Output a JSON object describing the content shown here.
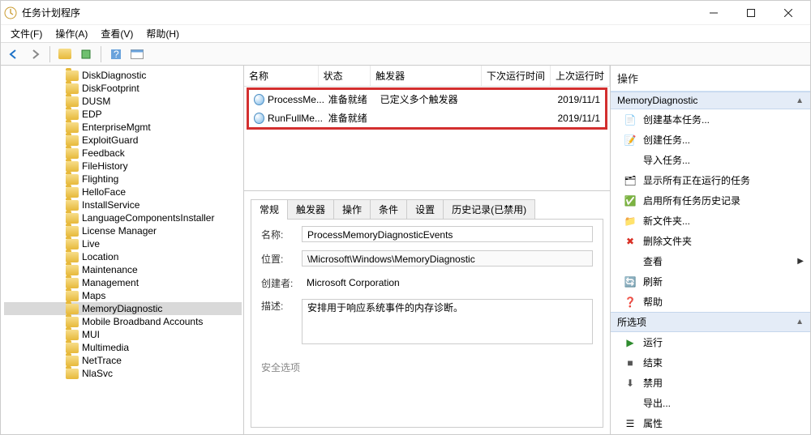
{
  "window": {
    "title": "任务计划程序"
  },
  "menu": {
    "file": "文件(F)",
    "action": "操作(A)",
    "view": "查看(V)",
    "help": "帮助(H)"
  },
  "tree": {
    "items": [
      "DiskDiagnostic",
      "DiskFootprint",
      "DUSM",
      "EDP",
      "EnterpriseMgmt",
      "ExploitGuard",
      "Feedback",
      "FileHistory",
      "Flighting",
      "HelloFace",
      "InstallService",
      "LanguageComponentsInstaller",
      "License Manager",
      "Live",
      "Location",
      "Maintenance",
      "Management",
      "Maps",
      "MemoryDiagnostic",
      "Mobile Broadband Accounts",
      "MUI",
      "Multimedia",
      "NetTrace",
      "NlaSvc"
    ],
    "selected": "MemoryDiagnostic"
  },
  "tasklist": {
    "cols": {
      "name": "名称",
      "state": "状态",
      "trigger": "触发器",
      "next": "下次运行时间",
      "last": "上次运行时"
    },
    "rows": [
      {
        "name": "ProcessMe...",
        "state": "准备就绪",
        "trigger": "已定义多个触发器",
        "next": "",
        "last": "2019/11/1"
      },
      {
        "name": "RunFullMe...",
        "state": "准备就绪",
        "trigger": "",
        "next": "",
        "last": "2019/11/1"
      }
    ]
  },
  "tabs": {
    "general": "常规",
    "triggers": "触发器",
    "actions": "操作",
    "conditions": "条件",
    "settings": "设置",
    "history": "历史记录(已禁用)"
  },
  "details": {
    "name_label": "名称:",
    "name_value": "ProcessMemoryDiagnosticEvents",
    "loc_label": "位置:",
    "loc_value": "\\Microsoft\\Windows\\MemoryDiagnostic",
    "author_label": "创建者:",
    "author_value": "Microsoft Corporation",
    "desc_label": "描述:",
    "desc_value": "安排用于响应系统事件的内存诊断。",
    "security_label": "安全选项"
  },
  "actions": {
    "pane_title": "操作",
    "section1": "MemoryDiagnostic",
    "items1": [
      {
        "icon": "📄",
        "label": "创建基本任务..."
      },
      {
        "icon": "📝",
        "label": "创建任务..."
      },
      {
        "icon": "",
        "label": "导入任务..."
      },
      {
        "icon": "🗂",
        "label": "显示所有正在运行的任务"
      },
      {
        "icon": "✅",
        "label": "启用所有任务历史记录"
      },
      {
        "icon": "📁",
        "label": "新文件夹..."
      },
      {
        "icon": "✖",
        "label": "删除文件夹",
        "color": "#d93025"
      },
      {
        "icon": "",
        "label": "查看",
        "arrow": "▶"
      },
      {
        "icon": "🔄",
        "label": "刷新",
        "color": "#3a963a"
      },
      {
        "icon": "❓",
        "label": "帮助",
        "color": "#2a6fbf"
      }
    ],
    "section2": "所选项",
    "items2": [
      {
        "icon": "▶",
        "label": "运行",
        "color": "#2e8b2e"
      },
      {
        "icon": "■",
        "label": "结束",
        "color": "#555"
      },
      {
        "icon": "⬇",
        "label": "禁用",
        "color": "#555"
      },
      {
        "icon": "",
        "label": "导出..."
      },
      {
        "icon": "☰",
        "label": "属性"
      }
    ]
  }
}
